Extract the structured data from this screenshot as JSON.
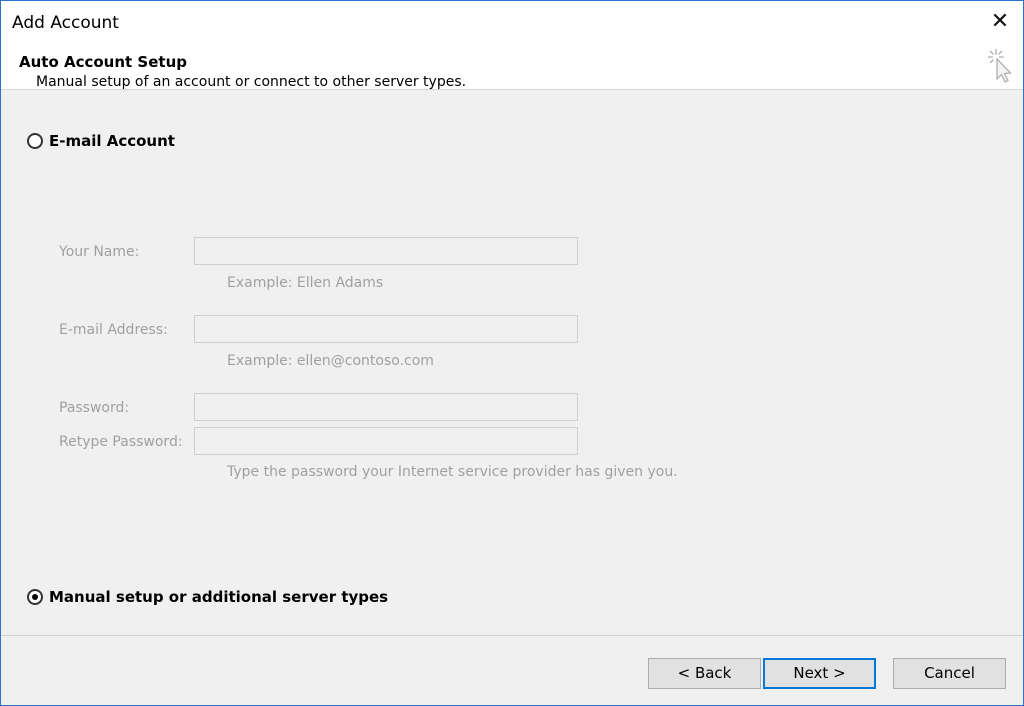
{
  "window": {
    "title": "Add Account",
    "close_icon": "close-icon",
    "border_color": "#2b74c8"
  },
  "header": {
    "title": "Auto Account Setup",
    "subtitle": "Manual setup of an account or connect to other server types.",
    "icon": "cursor-click-icon"
  },
  "options": {
    "email_account": {
      "label": "E-mail Account",
      "selected": false
    },
    "manual_setup": {
      "label": "Manual setup or additional server types",
      "selected": true
    }
  },
  "form": {
    "name_label": "Your Name:",
    "name_value": "",
    "name_hint": "Example: Ellen Adams",
    "email_label": "E-mail Address:",
    "email_value": "",
    "email_hint": "Example: ellen@contoso.com",
    "password_label": "Password:",
    "password_value": "",
    "retype_label": "Retype Password:",
    "retype_value": "",
    "password_hint": "Type the password your Internet service provider has given you."
  },
  "buttons": {
    "back": "< Back",
    "next": "Next >",
    "cancel": "Cancel",
    "accent": "#0078d7"
  }
}
